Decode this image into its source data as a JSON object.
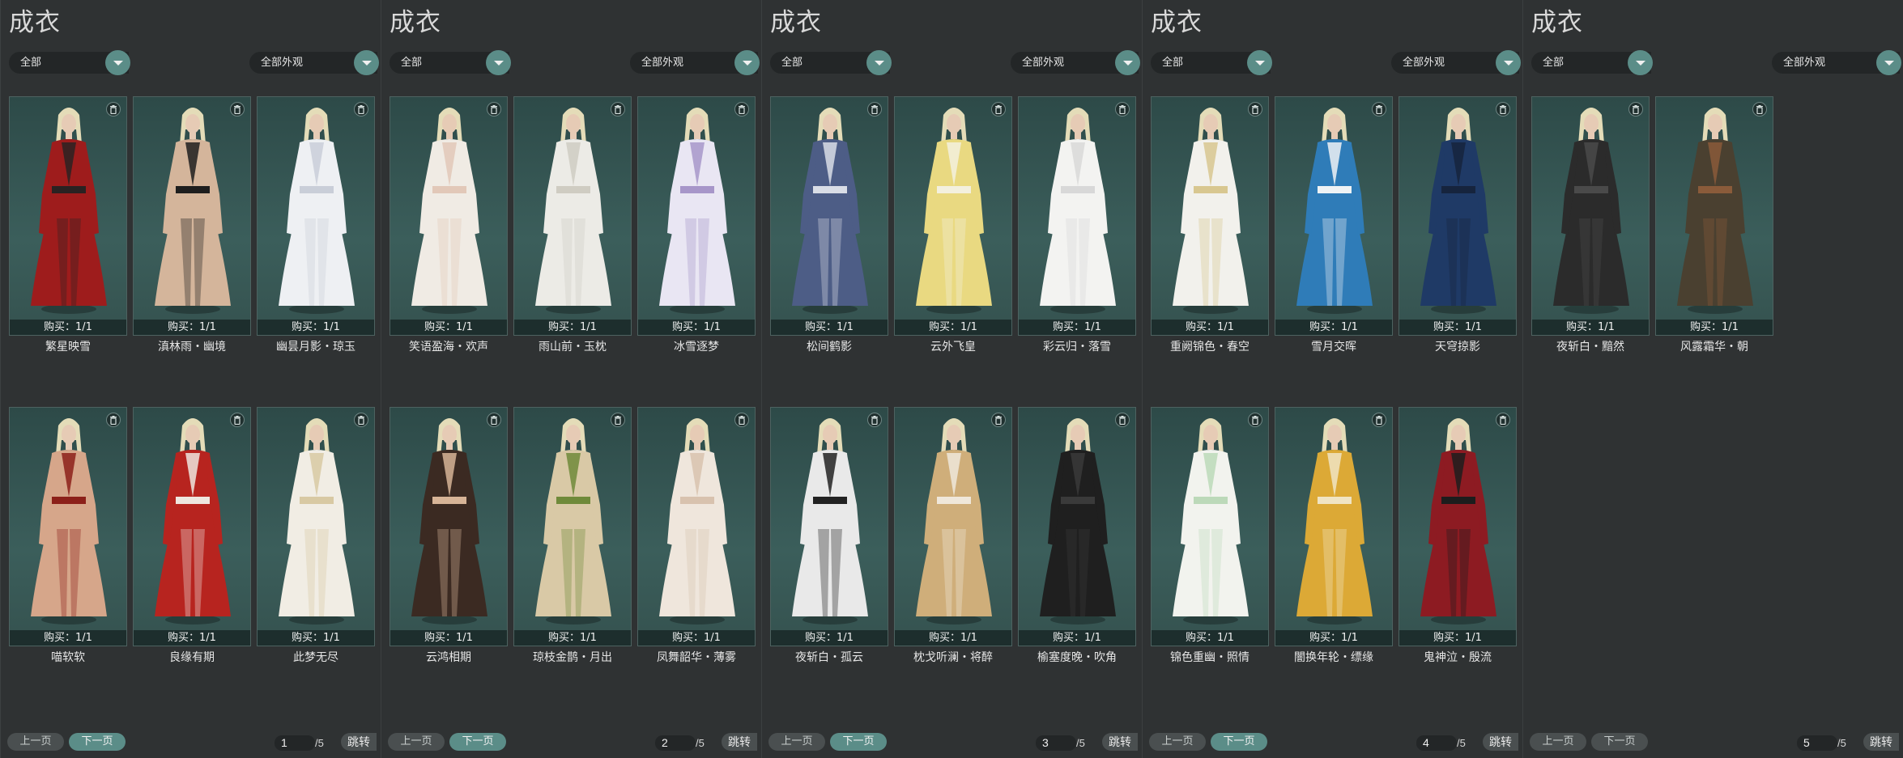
{
  "colors": {
    "accent": "#5b8d88",
    "background": "#2f3233",
    "card": "#3b5e5b"
  },
  "panels": [
    {
      "title": "成衣",
      "filter_category": "全部",
      "filter_appearance": "全部外观",
      "cards": [
        {
          "name": "繁星映雪",
          "buy": "购买：1/1",
          "palette": [
            "#9e1c1c",
            "#2a2222"
          ]
        },
        {
          "name": "滇林雨・幽境",
          "buy": "购买：1/1",
          "palette": [
            "#d4b59b",
            "#1e1e1e"
          ]
        },
        {
          "name": "幽昙月影・琼玉",
          "buy": "购买：1/1",
          "palette": [
            "#eef0f3",
            "#c9ced8"
          ]
        },
        {
          "name": "喵软软",
          "buy": "购买：1/1",
          "palette": [
            "#d6a68a",
            "#8c2019"
          ]
        },
        {
          "name": "良缘有期",
          "buy": "购买：1/1",
          "palette": [
            "#b7241f",
            "#eee6df"
          ]
        },
        {
          "name": "此梦无尽",
          "buy": "购买：1/1",
          "palette": [
            "#f1ede4",
            "#d8c9a3"
          ]
        }
      ],
      "pager": {
        "prev": "上一页",
        "next": "下一页",
        "page": "1",
        "total": "/5",
        "jump": "跳转",
        "next_enabled": true
      }
    },
    {
      "title": "成衣",
      "filter_category": "全部",
      "filter_appearance": "全部外观",
      "cards": [
        {
          "name": "笑语盈海・欢声",
          "buy": "购买：1/1",
          "palette": [
            "#f0ebe4",
            "#e2c8b8"
          ]
        },
        {
          "name": "雨山前・玉枕",
          "buy": "购买：1/1",
          "palette": [
            "#ecebe6",
            "#cfccc2"
          ]
        },
        {
          "name": "冰雪逐梦",
          "buy": "购买：1/1",
          "palette": [
            "#e9e6f3",
            "#a796c9"
          ]
        },
        {
          "name": "云鸿相期",
          "buy": "购买：1/1",
          "palette": [
            "#3b2a22",
            "#d7b497"
          ]
        },
        {
          "name": "琼枝金鹊・月出",
          "buy": "购买：1/1",
          "palette": [
            "#d9c9a6",
            "#6f8a3a"
          ]
        },
        {
          "name": "凤舞韶华・薄雾",
          "buy": "购买：1/1",
          "palette": [
            "#efe6dc",
            "#d8c2ae"
          ]
        }
      ],
      "pager": {
        "prev": "上一页",
        "next": "下一页",
        "page": "2",
        "total": "/5",
        "jump": "跳转",
        "next_enabled": true
      }
    },
    {
      "title": "成衣",
      "filter_category": "全部",
      "filter_appearance": "全部外观",
      "cards": [
        {
          "name": "松间鹤影",
          "buy": "购买：1/1",
          "palette": [
            "#4d5d86",
            "#d9dde6"
          ]
        },
        {
          "name": "云外飞皇",
          "buy": "购买：1/1",
          "palette": [
            "#e9d981",
            "#f3f0de"
          ]
        },
        {
          "name": "彩云归・落雪",
          "buy": "购买：1/1",
          "palette": [
            "#f3f3f1",
            "#d8d8d8"
          ]
        },
        {
          "name": "夜斩白・孤云",
          "buy": "购买：1/1",
          "palette": [
            "#e9e9e9",
            "#222222"
          ]
        },
        {
          "name": "枕戈听澜・将醉",
          "buy": "购买：1/1",
          "palette": [
            "#cfae7a",
            "#efe7da"
          ]
        },
        {
          "name": "榆塞度晚・吹角",
          "buy": "购买：1/1",
          "palette": [
            "#1f1f1f",
            "#3a3a3a"
          ]
        }
      ],
      "pager": {
        "prev": "上一页",
        "next": "下一页",
        "page": "3",
        "total": "/5",
        "jump": "跳转",
        "next_enabled": true
      }
    },
    {
      "title": "成衣",
      "filter_category": "全部",
      "filter_appearance": "全部外观",
      "cards": [
        {
          "name": "重阙锦色・春空",
          "buy": "购买：1/1",
          "palette": [
            "#f2f1ec",
            "#d8c790"
          ]
        },
        {
          "name": "雪月交晖",
          "buy": "购买：1/1",
          "palette": [
            "#2f7cb8",
            "#eef2f4"
          ]
        },
        {
          "name": "天穹掠影",
          "buy": "购买：1/1",
          "palette": [
            "#1f3a66",
            "#16243d"
          ]
        },
        {
          "name": "锦色重幽・照情",
          "buy": "购买：1/1",
          "palette": [
            "#f2f3ee",
            "#bcd9b9"
          ]
        },
        {
          "name": "闇换年轮・缥缘",
          "buy": "购买：1/1",
          "palette": [
            "#dca936",
            "#f0e4c3"
          ]
        },
        {
          "name": "鬼神泣・殷流",
          "buy": "购买：1/1",
          "palette": [
            "#8d1b22",
            "#1d1d1d"
          ]
        }
      ],
      "pager": {
        "prev": "上一页",
        "next": "下一页",
        "page": "4",
        "total": "/5",
        "jump": "跳转",
        "next_enabled": true
      }
    },
    {
      "title": "成衣",
      "filter_category": "全部",
      "filter_appearance": "全部外观",
      "cards": [
        {
          "name": "夜斩白・黯然",
          "buy": "购买：1/1",
          "palette": [
            "#2b2b2b",
            "#4a4a4a"
          ]
        },
        {
          "name": "风露霜华・朝",
          "buy": "购买：1/1",
          "palette": [
            "#4a4030",
            "#8a5b3a"
          ]
        }
      ],
      "pager": {
        "prev": "上一页",
        "next": "下一页",
        "page": "5",
        "total": "/5",
        "jump": "跳转",
        "next_enabled": false
      }
    }
  ]
}
